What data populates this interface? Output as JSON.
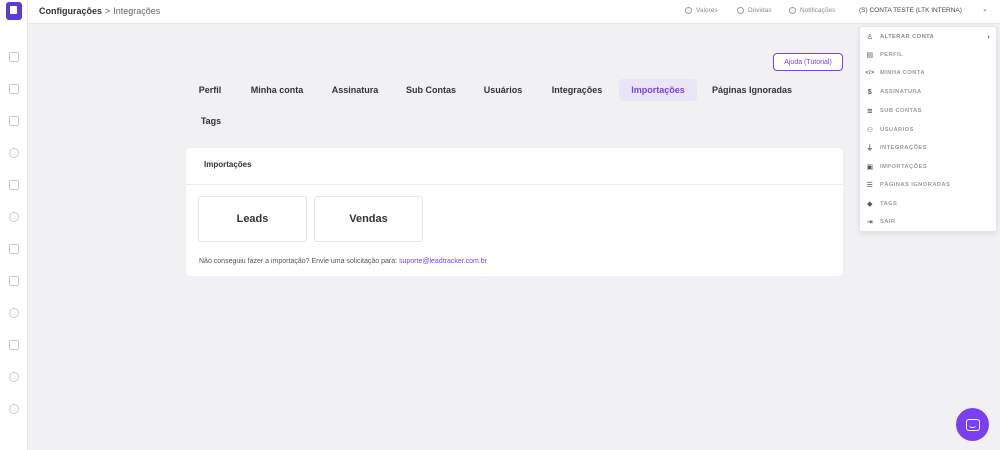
{
  "header": {
    "breadcrumb_root": "Configurações",
    "breadcrumb_separator": ">",
    "breadcrumb_current": "Integrações",
    "nav": [
      {
        "label": "Valores",
        "icon": "eye-off-icon"
      },
      {
        "label": "Dúvidas",
        "icon": "help-circle-icon"
      },
      {
        "label": "Notificações",
        "icon": "bell-icon"
      }
    ],
    "account_label": "(S) CONTA TESTE (LTK INTERNA)",
    "account_chevron": "⌄"
  },
  "help_button": "Ajuda (Tutorial)",
  "tabs": [
    {
      "label": "Perfil"
    },
    {
      "label": "Minha conta"
    },
    {
      "label": "Assinatura"
    },
    {
      "label": "Sub Contas"
    },
    {
      "label": "Usuários"
    },
    {
      "label": "Integrações"
    },
    {
      "label": "Importações",
      "active": true
    },
    {
      "label": "Páginas Ignoradas"
    },
    {
      "label": "Tags"
    }
  ],
  "card": {
    "title": "Importações",
    "buttons": [
      "Leads",
      "Vendas"
    ],
    "note_prefix": "Não conseguiu fazer a importação? Envie uma solicitação para: ",
    "note_email": "suporte@leadtracker.com.br"
  },
  "dropdown": {
    "items": [
      {
        "label": "ALTERAR CONTA",
        "icon": "user-switch-icon",
        "glyph": "♙",
        "has_submenu": true
      },
      {
        "label": "PERFIL",
        "icon": "id-card-icon",
        "glyph": "▤"
      },
      {
        "label": "MINHA CONTA",
        "icon": "code-icon",
        "glyph": "</>"
      },
      {
        "label": "ASSINATURA",
        "icon": "dollar-icon",
        "glyph": "$"
      },
      {
        "label": "SUB CONTAS",
        "icon": "layers-icon",
        "glyph": "≋"
      },
      {
        "label": "USUÁRIOS",
        "icon": "users-icon",
        "glyph": "⚇"
      },
      {
        "label": "INTEGRAÇÕES",
        "icon": "plug-icon",
        "glyph": "⏚"
      },
      {
        "label": "IMPORTAÇÕES",
        "icon": "file-import-icon",
        "glyph": "▣"
      },
      {
        "label": "PÁGINAS IGNORADAS",
        "icon": "list-icon",
        "glyph": "☰"
      },
      {
        "label": "TAGS",
        "icon": "tag-icon",
        "glyph": "◆"
      },
      {
        "label": "SAIR",
        "icon": "logout-icon",
        "glyph": "⇥"
      }
    ],
    "submenu_chevron": "›"
  },
  "colors": {
    "accent": "#7b3ff2",
    "brand": "#5b3bd4",
    "background": "#f1f1f4",
    "active_tab_bg": "#e9e5f7"
  }
}
